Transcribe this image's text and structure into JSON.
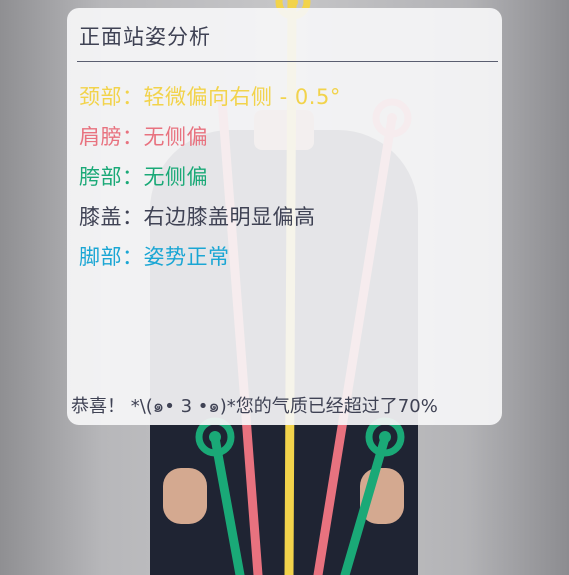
{
  "card": {
    "title": "正面站姿分析",
    "rows": [
      {
        "label": "颈部：轻微偏向右侧 - 0.5°",
        "color": "#f2d34b"
      },
      {
        "label": "肩膀：无侧偏",
        "color": "#e8727f"
      },
      {
        "label": "胯部：无侧偏",
        "color": "#1aa977"
      },
      {
        "label": "膝盖：右边膝盖明显偏高",
        "color": "#3f4254"
      },
      {
        "label": "脚部：姿势正常",
        "color": "#1aa6d4"
      }
    ],
    "footer": "恭喜！ *\\(๑• 3 •๑)*您的气质已经超过了70%"
  },
  "colors": {
    "neck": "#f2d34b",
    "shoulder": "#e8727f",
    "hip": "#1aa977"
  },
  "icons": [
    "head-marker-icon",
    "shoulder-marker-icon",
    "knee-marker-icon"
  ]
}
